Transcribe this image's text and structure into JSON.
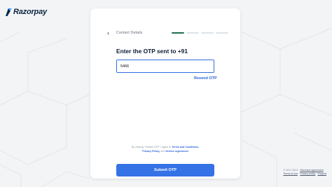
{
  "brand": {
    "name": "Razorpay",
    "color": "#0a2540",
    "accent": "#3395ff"
  },
  "header": {
    "title": "Contact Details",
    "progress_steps": 4,
    "progress_done": 1
  },
  "otp": {
    "title": "Enter the OTP sent to +91",
    "value": "5466",
    "resend_label": "Resend OTP"
  },
  "terms": {
    "prefix": "By clicking \"Submit OTP\" I agree to",
    "link1": "Terms and Conditions,",
    "link2": "Privacy Policy,",
    "middle": "and",
    "link3": "Service Agreement"
  },
  "submit_label": "Submit OTP",
  "footer": {
    "copyright": "© 2017-2022 ·",
    "links": [
      "Merchant agreement",
      "Terms of use",
      "Privacy policy",
      "Support"
    ]
  },
  "colors": {
    "primary": "#3472e6",
    "progress_done": "#1e6f4f",
    "background": "#f3f4f6"
  }
}
